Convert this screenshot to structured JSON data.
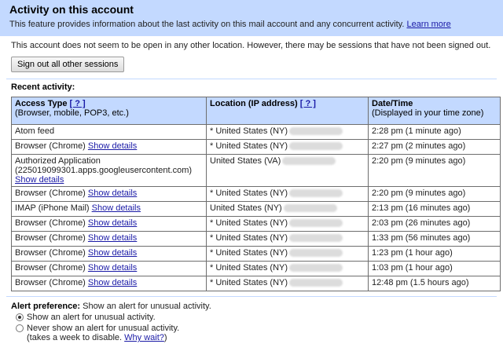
{
  "header": {
    "title": "Activity on this account",
    "description": "This feature provides information about the last activity on this mail account and any concurrent activity.",
    "learn_more": "Learn more"
  },
  "status_text": "This account does not seem to be open in any other location. However, there may be sessions that have not been signed out.",
  "sign_out_button": "Sign out all other sessions",
  "recent_activity_title": "Recent activity:",
  "table": {
    "headers": {
      "access_type": "Access Type",
      "access_type_help": "[ ? ]",
      "access_type_sub": "(Browser, mobile, POP3, etc.)",
      "location": "Location (IP address)",
      "location_help": "[ ? ]",
      "datetime": "Date/Time",
      "datetime_sub": "(Displayed in your time zone)"
    },
    "rows": [
      {
        "access": "Atom feed",
        "access_extra": "",
        "details": "",
        "location": "* United States (NY)",
        "time": "2:28 pm (1 minute ago)"
      },
      {
        "access": "Browser (Chrome)",
        "access_extra": "",
        "details": "Show details",
        "location": "* United States (NY)",
        "time": "2:27 pm (2 minutes ago)"
      },
      {
        "access": "Authorized Application",
        "access_extra": "(225019099301.apps.googleusercontent.com)",
        "details": "Show details",
        "location": "United States (VA)",
        "time": "2:20 pm (9 minutes ago)"
      },
      {
        "access": "Browser (Chrome)",
        "access_extra": "",
        "details": "Show details",
        "location": "* United States (NY)",
        "time": "2:20 pm (9 minutes ago)"
      },
      {
        "access": "IMAP (iPhone Mail)",
        "access_extra": "",
        "details": "Show details",
        "location": "United States (NY)",
        "time": "2:13 pm (16 minutes ago)"
      },
      {
        "access": "Browser (Chrome)",
        "access_extra": "",
        "details": "Show details",
        "location": "* United States (NY)",
        "time": "2:03 pm (26 minutes ago)"
      },
      {
        "access": "Browser (Chrome)",
        "access_extra": "",
        "details": "Show details",
        "location": "* United States (NY)",
        "time": "1:33 pm (56 minutes ago)"
      },
      {
        "access": "Browser (Chrome)",
        "access_extra": "",
        "details": "Show details",
        "location": "* United States (NY)",
        "time": "1:23 pm (1 hour ago)"
      },
      {
        "access": "Browser (Chrome)",
        "access_extra": "",
        "details": "Show details",
        "location": "* United States (NY)",
        "time": "1:03 pm (1 hour ago)"
      },
      {
        "access": "Browser (Chrome)",
        "access_extra": "",
        "details": "Show details",
        "location": "* United States (NY)",
        "time": "12:48 pm (1.5 hours ago)"
      }
    ]
  },
  "alert": {
    "label": "Alert preference:",
    "label_text": "Show an alert for unusual activity.",
    "option_show": "Show an alert for unusual activity.",
    "option_never": "Never show an alert for unusual activity.",
    "option_never_note": "(takes a week to disable.",
    "why_wait": "Why wait?",
    "option_never_note_end": ")",
    "selected": "show"
  }
}
